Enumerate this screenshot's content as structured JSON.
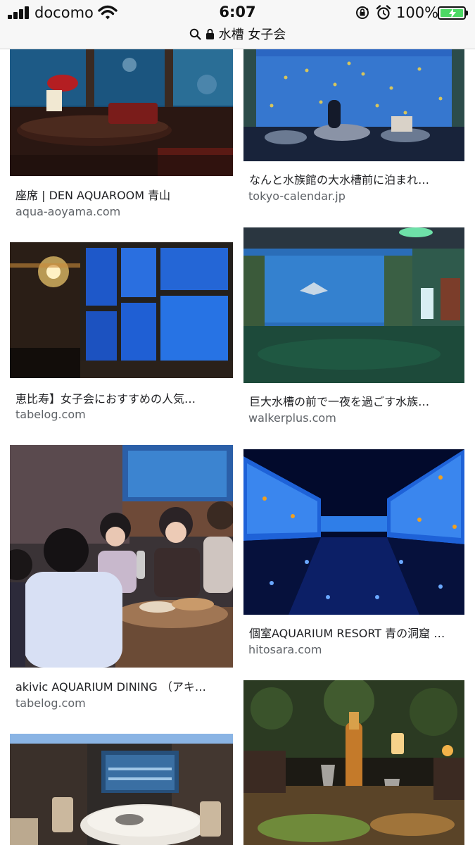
{
  "status_bar": {
    "carrier": "docomo",
    "time": "6:07",
    "battery_percent": "100%"
  },
  "url_bar": {
    "query": "水槽 女子会",
    "icons": [
      "search-icon",
      "lock-icon"
    ]
  },
  "results": [
    {
      "title": "座席 | DEN AQUAROOM 青山",
      "domain": "aqua-aoyama.com",
      "image": "restaurant-aquarium-dining-table"
    },
    {
      "title": "なんと水族館の大水槽前に泊まれ…",
      "domain": "tokyo-calendar.jp",
      "image": "aquarium-big-tank-with-sleepers"
    },
    {
      "title": "恵比寿】女子会におすすめの人気…",
      "domain": "tabelog.com",
      "image": "chandelier-bar-aquarium-windows"
    },
    {
      "title": "巨大水槽の前で一夜を過ごす水族…",
      "domain": "walkerplus.com",
      "image": "aquarium-hall-manta-ray"
    },
    {
      "title": "akivic AQUARIUM DINING （アキ…",
      "domain": "tabelog.com",
      "image": "women-toasting-at-dinner"
    },
    {
      "title": "個室AQUARIUM RESORT 青の洞窟 …",
      "domain": "hitosara.com",
      "image": "blue-aquarium-corridor"
    },
    {
      "title": "",
      "domain": "",
      "image": "private-room-round-table"
    },
    {
      "title": "",
      "domain": "",
      "image": "champagne-candle-dinner"
    }
  ],
  "colors": {
    "battery_fill": "#4cd964",
    "domain_text": "#5f6368",
    "title_text": "#202124"
  }
}
